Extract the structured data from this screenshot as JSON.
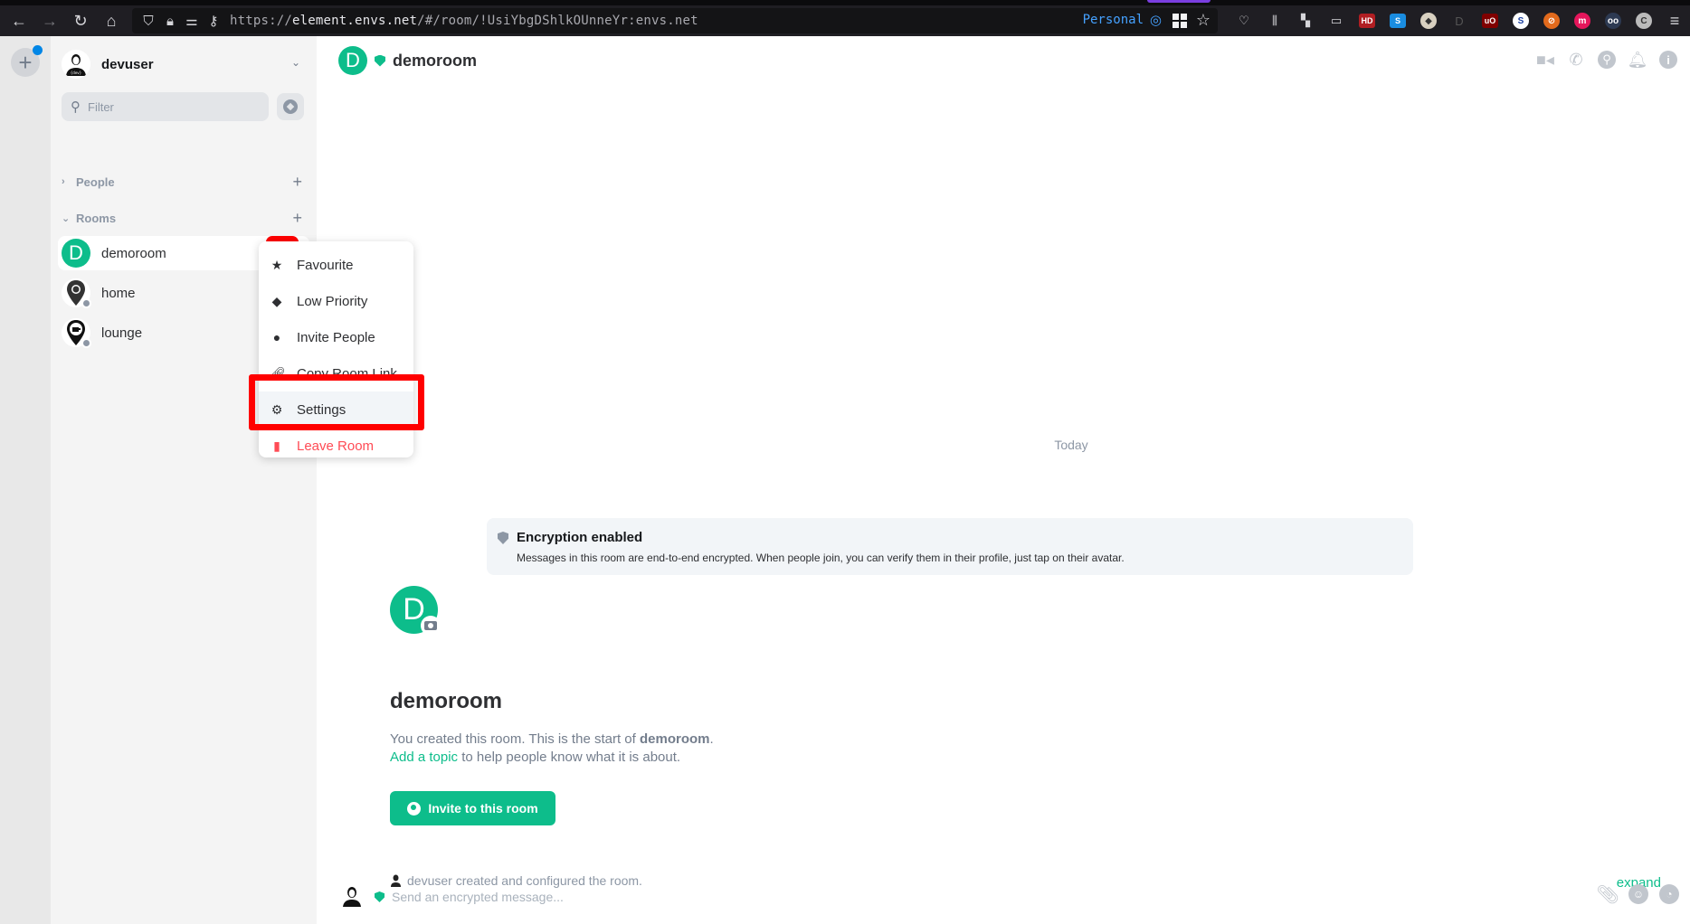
{
  "browser": {
    "url_prefix": "https://",
    "url_host": "element.envs.net",
    "url_path": "/#/room/!UsiYbgDShlkOUnneYr:envs.net",
    "container_label": "Personal",
    "extensions": [
      "pocket-icon",
      "library-icon",
      "extensions-icon",
      "sidebar-icon",
      "hd-icon",
      "s-icon",
      "badger-icon",
      "d-icon",
      "ublock-icon",
      "s-red-icon",
      "noscript-icon",
      "m-icon",
      "spy-icon",
      "account-icon",
      "menu-icon"
    ]
  },
  "spaces": {
    "add_label": "+"
  },
  "sidebar": {
    "user": {
      "name": "devuser",
      "avatar_label": "{dev}"
    },
    "filter_placeholder": "Filter",
    "sections": [
      {
        "label": "People",
        "expanded": false
      },
      {
        "label": "Rooms",
        "expanded": true
      }
    ],
    "rooms": [
      {
        "name": "demoroom",
        "avatar_letter": "D",
        "selected": true
      },
      {
        "name": "home",
        "avatar": "pin-home"
      },
      {
        "name": "lounge",
        "avatar": "pin-lounge"
      }
    ],
    "more_label": "...",
    "bell": "🔔"
  },
  "context_menu": {
    "items": [
      {
        "label": "Favourite",
        "icon": "★"
      },
      {
        "label": "Low Priority",
        "icon": "◆"
      },
      {
        "label": "Invite People",
        "icon": "●"
      },
      {
        "label": "Copy Room Link",
        "icon": "🔗"
      },
      {
        "label": "Settings",
        "icon": "⚙",
        "highlighted": true
      },
      {
        "label": "Leave Room",
        "icon": "▮",
        "danger": true
      }
    ]
  },
  "header": {
    "room_name": "demoroom",
    "avatar_letter": "D",
    "icons": [
      "video-call-icon",
      "voice-call-icon",
      "search-icon",
      "notifications-icon",
      "room-info-icon"
    ]
  },
  "timeline": {
    "date_separator": "Today",
    "encryption": {
      "title": "Encryption enabled",
      "description": "Messages in this room are end-to-end encrypted. When people join, you can verify them in their profile, just tap on their avatar."
    },
    "intro": {
      "avatar_letter": "D",
      "room_name": "demoroom",
      "line1_prefix": "You created this room. This is the start of ",
      "line1_room": "demoroom",
      "line1_suffix": ".",
      "topic_link": "Add a topic",
      "line2_suffix": " to help people know what it is about.",
      "invite_button": "Invite to this room"
    },
    "summary": "devuser created and configured the room.",
    "expand_label": "expand"
  },
  "composer": {
    "placeholder": "Send an encrypted message..."
  },
  "colors": {
    "accent": "#0dbd8b",
    "danger": "#ff4b55",
    "highlight_box": "#ff0000",
    "link": "#0dbd8b"
  }
}
